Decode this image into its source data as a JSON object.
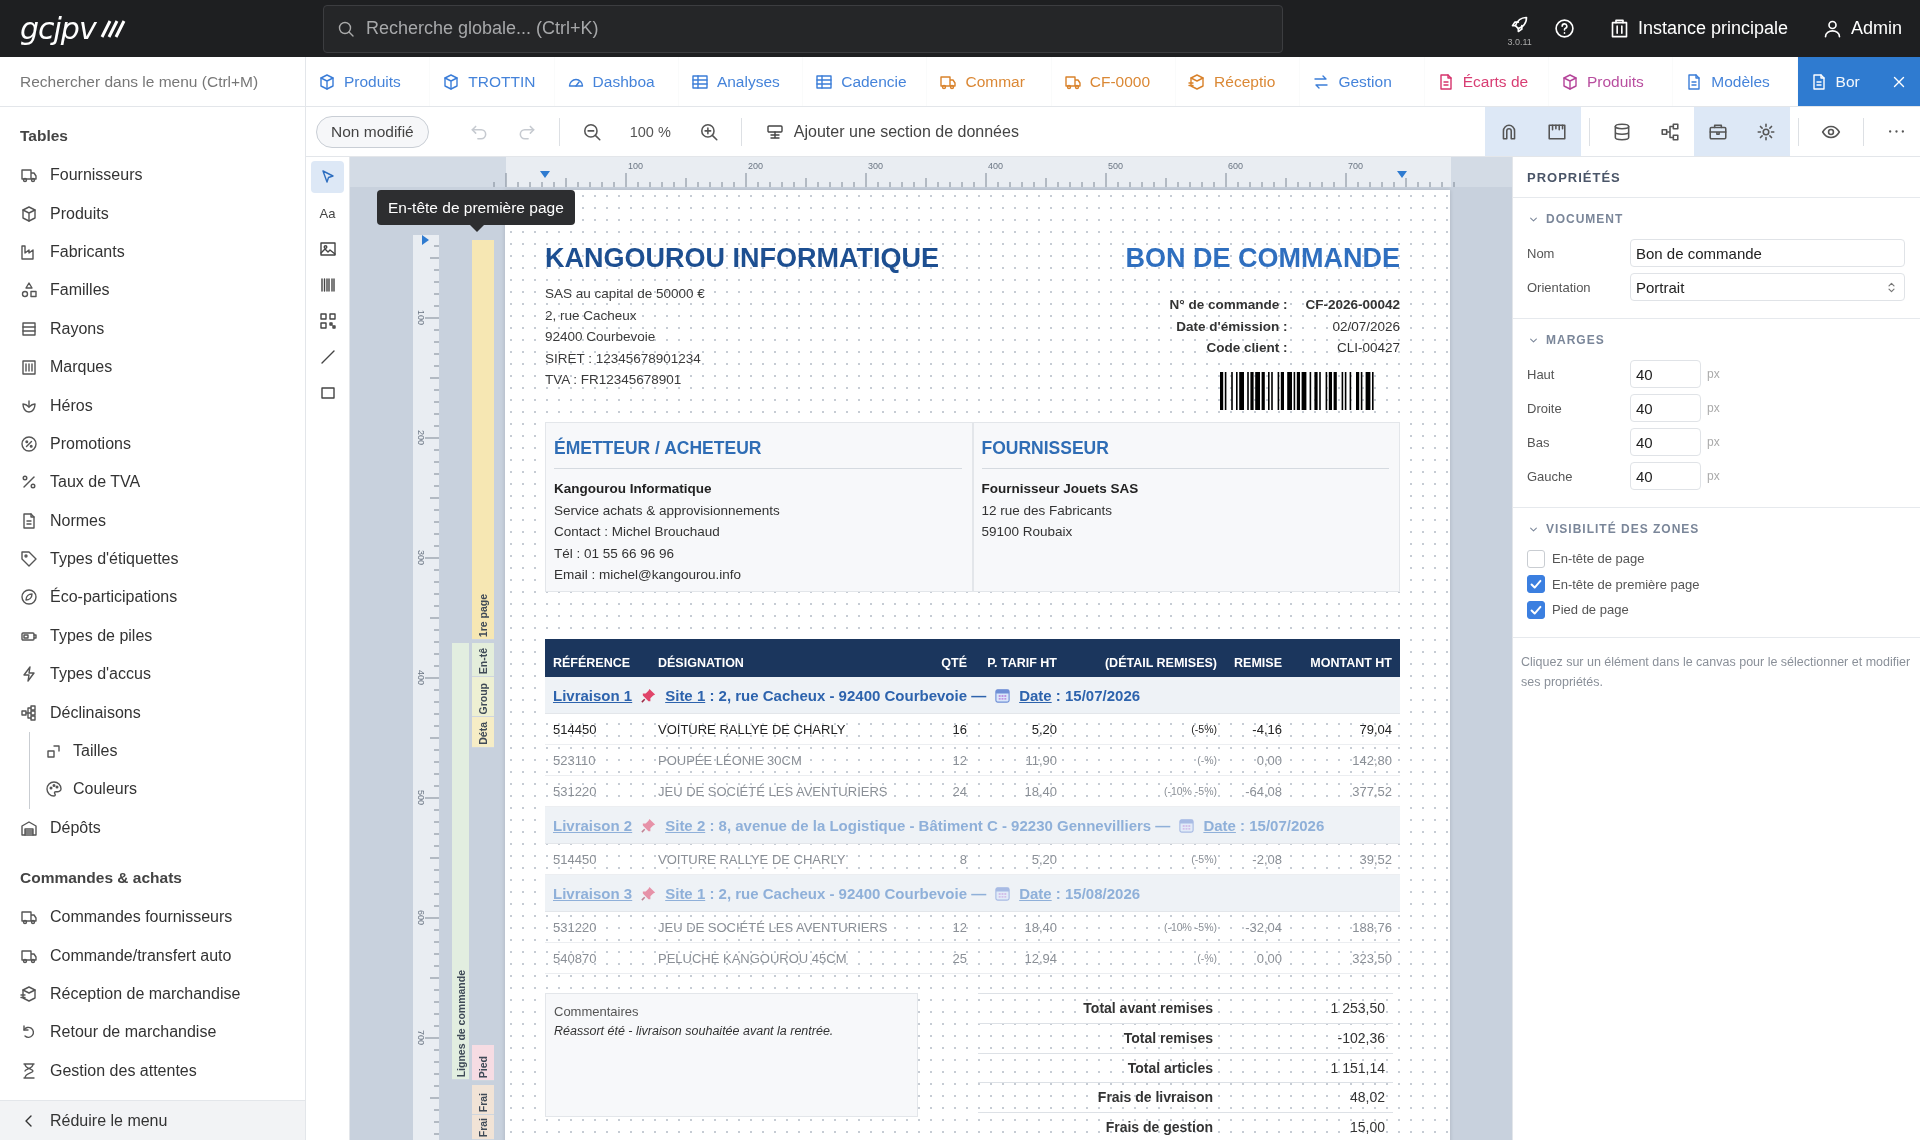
{
  "topbar": {
    "logo": "gcjpv",
    "search": {
      "placeholder": "Recherche globale... (Ctrl+K)"
    },
    "version": "3.0.11",
    "instance": "Instance principale",
    "user": "Admin"
  },
  "sidebar": {
    "search": {
      "placeholder": "Rechercher dans le menu (Ctrl+M)"
    },
    "sections": [
      {
        "title": "Tables",
        "items": [
          {
            "label": "Fournisseurs"
          },
          {
            "label": "Produits"
          },
          {
            "label": "Fabricants"
          },
          {
            "label": "Familles"
          },
          {
            "label": "Rayons"
          },
          {
            "label": "Marques"
          },
          {
            "label": "Héros"
          },
          {
            "label": "Promotions"
          },
          {
            "label": "Taux de TVA"
          },
          {
            "label": "Normes"
          },
          {
            "label": "Types d'étiquettes"
          },
          {
            "label": "Éco-participations"
          },
          {
            "label": "Types de piles"
          },
          {
            "label": "Types d'accus"
          },
          {
            "label": "Déclinaisons",
            "children": [
              {
                "label": "Tailles"
              },
              {
                "label": "Couleurs"
              }
            ]
          },
          {
            "label": "Dépôts"
          }
        ]
      },
      {
        "title": "Commandes & achats",
        "items": [
          {
            "label": "Commandes fournisseurs"
          },
          {
            "label": "Commande/transfert auto"
          },
          {
            "label": "Réception de marchandise"
          },
          {
            "label": "Retour de marchandise"
          },
          {
            "label": "Gestion des attentes"
          }
        ]
      }
    ],
    "collapse": "Réduire le menu"
  },
  "tabs": [
    {
      "label": "Produits",
      "color": "#3b7dd8",
      "selected": false
    },
    {
      "label": "TROTTIN",
      "color": "#3b7dd8",
      "selected": false
    },
    {
      "label": "Dashboa",
      "color": "#3b7dd8",
      "selected": false
    },
    {
      "label": "Analyses",
      "color": "#3b7dd8",
      "selected": false
    },
    {
      "label": "Cadencie",
      "color": "#3b7dd8",
      "selected": false
    },
    {
      "label": "Commar",
      "color": "#d9822b",
      "selected": false
    },
    {
      "label": "CF-0000",
      "color": "#d9822b",
      "selected": false
    },
    {
      "label": "Réceptio",
      "color": "#d9822b",
      "selected": false
    },
    {
      "label": "Gestion",
      "color": "#3b7dd8",
      "selected": false
    },
    {
      "label": "Écarts de",
      "color": "#d6336c",
      "selected": false
    },
    {
      "label": "Produits",
      "color": "#b5459a",
      "selected": false
    },
    {
      "label": "Modèles",
      "color": "#3b7dd8",
      "selected": false
    },
    {
      "label": "Bor",
      "color": "#2f7bd0",
      "selected": true
    }
  ],
  "toolbar": {
    "status": "Non modifié",
    "history": [
      {
        "kind": "undo",
        "disabled": true
      },
      {
        "kind": "redo",
        "disabled": true
      }
    ],
    "zoom": "100 %",
    "add_section": "Ajouter une section de données",
    "toggles": [
      {
        "kind": "magnet",
        "active": true
      },
      {
        "kind": "ruler",
        "active": true
      },
      {
        "kind": "database",
        "active": false
      },
      {
        "kind": "nodes",
        "active": false
      },
      {
        "kind": "toolbox",
        "active": true
      },
      {
        "kind": "gear",
        "active": true
      },
      {
        "kind": "eye",
        "active": false
      },
      {
        "kind": "more",
        "active": false
      }
    ]
  },
  "tools": [
    {
      "kind": "select",
      "selected": true
    },
    {
      "kind": "text",
      "label": "Aa",
      "selected": false
    },
    {
      "kind": "image",
      "selected": false
    },
    {
      "kind": "barcode",
      "selected": false
    },
    {
      "kind": "qr",
      "selected": false
    },
    {
      "kind": "line",
      "selected": false
    },
    {
      "kind": "rect",
      "selected": false
    }
  ],
  "tooltip": "En-tête de première page",
  "rulers": {
    "horizontal": [
      "100",
      "200",
      "300",
      "400",
      "500",
      "600",
      "700"
    ],
    "vertical": [
      "100",
      "200",
      "300",
      "400",
      "500",
      "600",
      "700"
    ]
  },
  "bands": [
    {
      "label": "1re page",
      "color": "#f6e7b3"
    },
    {
      "label": "En-tê",
      "color": "#e4eedb"
    },
    {
      "label": "Group",
      "color": "#eef0d3"
    },
    {
      "label": "Déta",
      "color": "#f6edc6"
    },
    {
      "label": "Lignes de commande",
      "color": "#e2eee0"
    },
    {
      "label": "Pied",
      "color": "#f6dce3"
    },
    {
      "label": "Frai",
      "color": "#f1e3d6"
    },
    {
      "label": "Frai",
      "color": "#f1e3d6"
    }
  ],
  "document": {
    "company": "KANGOUROU INFORMATIQUE",
    "company_lines": [
      "SAS au capital de 50000 €",
      "2, rue Cacheux",
      "92400 Courbevoie",
      "SIRET : 12345678901234",
      "TVA : FR12345678901"
    ],
    "title": "BON DE COMMANDE",
    "meta": [
      {
        "label": "N° de commande :",
        "value": "CF-2026-00042",
        "bold": true
      },
      {
        "label": "Date d'émission :",
        "value": "02/07/2026",
        "bold": false
      },
      {
        "label": "Code client :",
        "value": "CLI-00427",
        "bold": false
      }
    ],
    "parties": [
      {
        "title": "ÉMETTEUR / ACHETEUR",
        "name": "Kangourou Informatique",
        "lines": [
          "Service achats & approvisionnements",
          "Contact : Michel Brouchaud",
          "Tél : 01 55 66 96 96",
          "Email : michel@kangourou.info"
        ]
      },
      {
        "title": "FOURNISSEUR",
        "name": "Fournisseur Jouets SAS",
        "lines": [
          "12 rue des Fabricants",
          "59100 Roubaix"
        ]
      }
    ],
    "table": {
      "columns": [
        "RÉFÉRENCE",
        "DÉSIGNATION",
        "QTÉ",
        "P. TARIF HT",
        "(DÉTAIL REMISES)",
        "REMISE",
        "MONTANT HT"
      ],
      "groups": [
        {
          "dimmed": false,
          "delivery": "Livraison 1",
          "site": "Site 1",
          "address": " : 2, rue Cacheux - 92400 Courbevoie —",
          "date_label": "Date",
          "date": " : 15/07/2026",
          "rows": [
            {
              "dimmed": false,
              "cells": [
                "514450",
                "VOITURE RALLYE DE CHARLY",
                "16",
                "5,20",
                "(-5%)",
                "-4,16",
                "79,04"
              ]
            },
            {
              "dimmed": true,
              "cells": [
                "523110",
                "POUPÉE LÉONIE 30CM",
                "12",
                "11,90",
                "(-%)",
                "0,00",
                "142,80"
              ]
            },
            {
              "dimmed": true,
              "cells": [
                "531220",
                "JEU DE SOCIÉTÉ LES AVENTURIERS",
                "24",
                "18,40",
                "(-10% -5%)",
                "-64,08",
                "377,52"
              ]
            }
          ]
        },
        {
          "dimmed": true,
          "delivery": "Livraison 2",
          "site": "Site 2",
          "address": " : 8, avenue de la Logistique - Bâtiment C - 92230 Gennevilliers —",
          "date_label": "Date",
          "date": " : 15/07/2026",
          "rows": [
            {
              "dimmed": true,
              "cells": [
                "514450",
                "VOITURE RALLYE DE CHARLY",
                "8",
                "5,20",
                "(-5%)",
                "-2,08",
                "39,52"
              ]
            }
          ]
        },
        {
          "dimmed": true,
          "delivery": "Livraison 3",
          "site": "Site 1",
          "address": " : 2, rue Cacheux - 92400 Courbevoie —",
          "date_label": "Date",
          "date": " : 15/08/2026",
          "rows": [
            {
              "dimmed": true,
              "cells": [
                "531220",
                "JEU DE SOCIÉTÉ LES AVENTURIERS",
                "12",
                "18,40",
                "(-10% -5%)",
                "-32,04",
                "188,76"
              ]
            },
            {
              "dimmed": true,
              "cells": [
                "540870",
                "PELUCHE KANGOUROU 45CM",
                "25",
                "12,94",
                "(-%)",
                "0,00",
                "323,50"
              ]
            }
          ]
        }
      ]
    },
    "comments": {
      "title": "Commentaires",
      "text": "Réassort été - livraison souhaitée avant la rentrée."
    },
    "totals": [
      {
        "label": "Total avant remises",
        "value": "1 253,50"
      },
      {
        "label": "Total remises",
        "value": "-102,36"
      },
      {
        "label": "Total articles",
        "value": "1 151,14"
      },
      {
        "label": "Frais de livraison",
        "value": "48,02"
      },
      {
        "label": "Frais de gestion",
        "value": "15,00"
      }
    ]
  },
  "properties": {
    "title": "PROPRIÉTÉS",
    "sections": [
      {
        "title": "DOCUMENT",
        "expanded": true,
        "fields": [
          {
            "kind": "text",
            "label": "Nom",
            "value": "Bon de commande"
          },
          {
            "kind": "select",
            "label": "Orientation",
            "value": "Portrait"
          }
        ]
      },
      {
        "title": "MARGES",
        "expanded": true,
        "fields": [
          {
            "kind": "number",
            "label": "Haut",
            "value": "40",
            "unit": "px"
          },
          {
            "kind": "number",
            "label": "Droite",
            "value": "40",
            "unit": "px"
          },
          {
            "kind": "number",
            "label": "Bas",
            "value": "40",
            "unit": "px"
          },
          {
            "kind": "number",
            "label": "Gauche",
            "value": "40",
            "unit": "px"
          }
        ]
      },
      {
        "title": "VISIBILITÉ DES ZONES",
        "expanded": true,
        "fields": [
          {
            "kind": "checkbox",
            "label": "En-tête de page",
            "checked": false
          },
          {
            "kind": "checkbox",
            "label": "En-tête de première page",
            "checked": true
          },
          {
            "kind": "checkbox",
            "label": "Pied de page",
            "checked": true
          }
        ]
      }
    ],
    "hint": "Cliquez sur un élément dans le canvas pour le sélectionner et modifier ses propriétés."
  }
}
